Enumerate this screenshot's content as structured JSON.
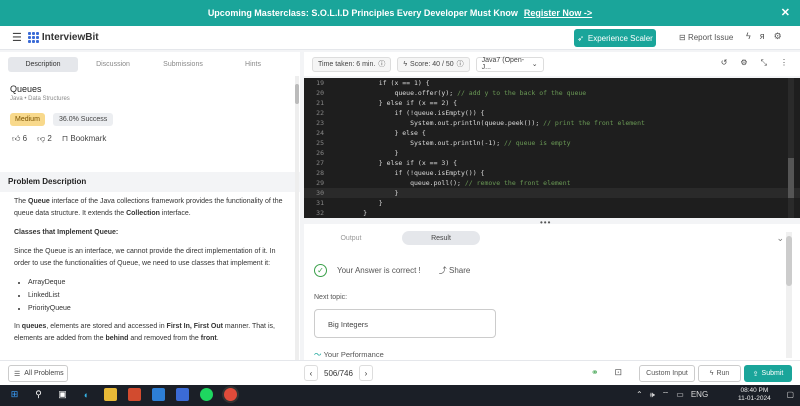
{
  "banner": {
    "text": "Upcoming Masterclass: S.O.L.I.D Principles Every Developer Must Know",
    "link": "Register Now ->",
    "close": "✕"
  },
  "nav": {
    "brand": "InterviewBit",
    "experience_button": "Experience Scaler",
    "report": "Report Issue"
  },
  "tabs": [
    "Description",
    "Discussion",
    "Submissions",
    "Hints"
  ],
  "toolbar": {
    "time": "Time taken: 6 min.",
    "score": "Score: 40 / 50",
    "language": "Java7 (Open-J..."
  },
  "problem": {
    "title": "Queues",
    "tags": "Java • Data Structures",
    "difficulty": "Medium",
    "success": "36.0% Success",
    "likes": "6",
    "dislikes": "2",
    "bookmark": "Bookmark"
  },
  "description": {
    "heading": "Problem Description",
    "p1_pre": "The ",
    "p1_b1": "Queue",
    "p1_mid": " interface of the Java collections framework provides the functionality of the queue data structure. It extends the ",
    "p1_b2": "Collection",
    "p1_post": " interface.",
    "subheading": "Classes that Implement Queue:",
    "p2": "Since the Queue is an interface, we cannot provide the direct implementation of it. In order to use the functionalities of Queue, we need to use classes that implement it:",
    "list": [
      "ArrayDeque",
      "LinkedList",
      "PriorityQueue"
    ],
    "p3_pre": "In ",
    "p3_b1": "queues",
    "p3_mid1": ", elements are stored and accessed in ",
    "p3_b2": "First In, First Out",
    "p3_mid2": " manner. That is, elements are added from the ",
    "p3_b3": "behind",
    "p3_mid3": " and removed from the ",
    "p3_b4": "front",
    "p3_post": "."
  },
  "code": [
    {
      "n": "19",
      "code": "            if (x == 1) {",
      "comment": ""
    },
    {
      "n": "20",
      "code": "                queue.offer(y); ",
      "comment": "// add y to the back of the queue"
    },
    {
      "n": "21",
      "code": "            } else if (x == 2) {",
      "comment": ""
    },
    {
      "n": "22",
      "code": "                if (!queue.isEmpty()) {",
      "comment": ""
    },
    {
      "n": "23",
      "code": "                    System.out.println(queue.peek()); ",
      "comment": "// print the front element"
    },
    {
      "n": "24",
      "code": "                } else {",
      "comment": ""
    },
    {
      "n": "25",
      "code": "                    System.out.println(-1); ",
      "comment": "// queue is empty"
    },
    {
      "n": "26",
      "code": "                }",
      "comment": ""
    },
    {
      "n": "27",
      "code": "            } else if (x == 3) {",
      "comment": ""
    },
    {
      "n": "28",
      "code": "                if (!queue.isEmpty()) {",
      "comment": ""
    },
    {
      "n": "29",
      "code": "                    queue.poll(); ",
      "comment": "// remove the front element"
    },
    {
      "n": "30",
      "code": "                }",
      "comment": ""
    },
    {
      "n": "31",
      "code": "            }",
      "comment": ""
    },
    {
      "n": "32",
      "code": "        }",
      "comment": ""
    }
  ],
  "result": {
    "tabs": [
      "Output",
      "Result"
    ],
    "message": "Your Answer is correct !",
    "share": "Share",
    "next_label": "Next topic:",
    "next_topic": "Big Integers",
    "performance": "Your Performance"
  },
  "bottom": {
    "all_problems": "All Problems",
    "page": "506/746",
    "custom_input": "Custom Input",
    "run": "Run",
    "submit": "Submit"
  },
  "taskbar": {
    "lang": "ENG",
    "time": "08:40 PM",
    "date": "11-01-2024"
  }
}
